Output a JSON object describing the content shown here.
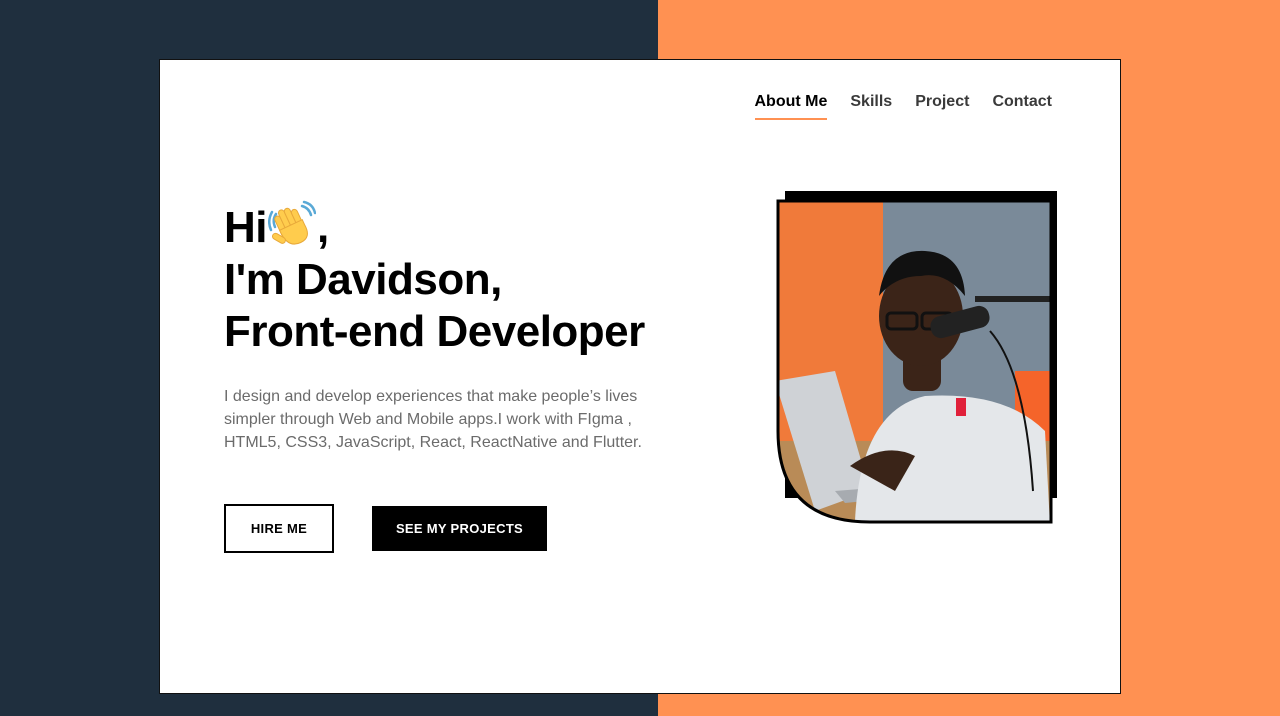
{
  "nav": {
    "items": [
      {
        "label": "About Me",
        "active": true
      },
      {
        "label": "Skills",
        "active": false
      },
      {
        "label": "Project",
        "active": false
      },
      {
        "label": "Contact",
        "active": false
      }
    ]
  },
  "hero": {
    "greeting": "Hi",
    "greeting_icon": "waving-hand-icon",
    "greeting_suffix": ",",
    "name_line": "I'm Davidson,",
    "role_line": "Front-end Developer",
    "intro": "I design and develop experiences that make people’s lives simpler through Web and Mobile apps.I work with FIgma , HTML5, CSS3, JavaScript, React, ReactNative and Flutter."
  },
  "buttons": {
    "hire": "HIRE ME",
    "projects": "SEE MY PROJECTS"
  },
  "colors": {
    "accent": "#ff9152",
    "dark_background": "#1f2f3e",
    "text": "#000000",
    "muted_text": "#6b6b6b"
  }
}
